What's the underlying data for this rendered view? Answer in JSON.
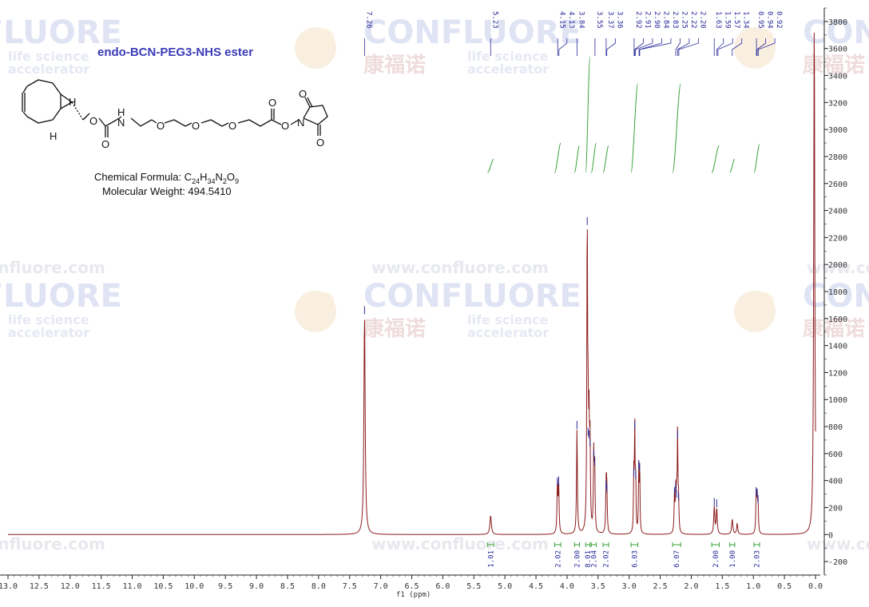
{
  "compound": {
    "name": "endo-BCN-PEG3-NHS ester",
    "formula_prefix": "Chemical Formula: ",
    "formula_parts": [
      [
        "C",
        false
      ],
      [
        "24",
        true
      ],
      [
        "H",
        false
      ],
      [
        "34",
        true
      ],
      [
        "N",
        false
      ],
      [
        "2",
        true
      ],
      [
        "O",
        false
      ],
      [
        "9",
        true
      ]
    ],
    "mw": "Molecular Weight: 494.5410"
  },
  "watermark": {
    "brand": "CONFLUORE",
    "cjk": "康福诺",
    "tag1": "life science",
    "tag2": "accelerator",
    "url": "www.confluore.com"
  },
  "colors": {
    "spectrum": "#8b1a1a",
    "integral_curve": "#3aa13a",
    "integral_marker": "#3aa13a",
    "peak_label": "#2a2a9a",
    "axis": "#222222"
  },
  "chart_data": {
    "type": "line",
    "xlabel": "f1 (ppm)",
    "xlim": [
      13.0,
      0.0
    ],
    "x_ticks": [
      "13.0",
      "12.5",
      "12.0",
      "11.5",
      "11.0",
      "10.5",
      "10.0",
      "9.5",
      "9.0",
      "8.5",
      "8.0",
      "7.5",
      "7.0",
      "6.5",
      "6.0",
      "5.5",
      "5.0",
      "4.5",
      "4.0",
      "3.5",
      "3.0",
      "2.5",
      "2.0",
      "1.5",
      "1.0",
      "0.5",
      "0.0"
    ],
    "ylim": [
      -300,
      3900
    ],
    "y_ticks": [
      "3800",
      "3600",
      "3400",
      "3200",
      "3000",
      "2800",
      "2600",
      "2400",
      "2200",
      "2000",
      "1800",
      "1600",
      "1400",
      "1200",
      "1000",
      "800",
      "600",
      "400",
      "200",
      "0",
      "-200"
    ],
    "peak_labels": [
      "7.26",
      "5.23",
      "4.15",
      "4.13",
      "3.84",
      "3.55",
      "3.37",
      "3.36",
      "2.92",
      "2.91",
      "2.90",
      "2.84",
      "2.83",
      "2.25",
      "2.22",
      "2.20",
      "1.63",
      "1.59",
      "1.57",
      "1.34",
      "0.95",
      "0.94",
      "0.92"
    ],
    "integrals": [
      {
        "from": 5.28,
        "to": 5.18,
        "value": "1.01"
      },
      {
        "from": 4.2,
        "to": 4.1,
        "value": "2.02"
      },
      {
        "from": 3.88,
        "to": 3.8,
        "value": "2.00"
      },
      {
        "from": 3.7,
        "to": 3.63,
        "value": "8.01"
      },
      {
        "from": 3.61,
        "to": 3.53,
        "value": "2.04"
      },
      {
        "from": 3.42,
        "to": 3.33,
        "value": "2.02"
      },
      {
        "from": 2.97,
        "to": 2.86,
        "value": "6.03"
      },
      {
        "from": 2.3,
        "to": 2.17,
        "value": "6.07"
      },
      {
        "from": 1.67,
        "to": 1.55,
        "value": "2.00"
      },
      {
        "from": 1.38,
        "to": 1.3,
        "value": "1.00"
      },
      {
        "from": 0.99,
        "to": 0.9,
        "value": "2.03"
      }
    ],
    "peaks": [
      {
        "ppm": 7.26,
        "height": 1620,
        "width": 0.012
      },
      {
        "ppm": 5.23,
        "height": 140,
        "width": 0.014
      },
      {
        "ppm": 4.155,
        "height": 350,
        "width": 0.008
      },
      {
        "ppm": 4.135,
        "height": 360,
        "width": 0.008
      },
      {
        "ppm": 3.84,
        "height": 770,
        "width": 0.008
      },
      {
        "ppm": 3.675,
        "height": 2280,
        "width": 0.007
      },
      {
        "ppm": 3.66,
        "height": 720,
        "width": 0.007
      },
      {
        "ppm": 3.645,
        "height": 700,
        "width": 0.007
      },
      {
        "ppm": 3.63,
        "height": 640,
        "width": 0.007
      },
      {
        "ppm": 3.57,
        "height": 560,
        "width": 0.007
      },
      {
        "ppm": 3.555,
        "height": 500,
        "width": 0.007
      },
      {
        "ppm": 3.37,
        "height": 330,
        "width": 0.008
      },
      {
        "ppm": 3.36,
        "height": 300,
        "width": 0.008
      },
      {
        "ppm": 2.925,
        "height": 420,
        "width": 0.006
      },
      {
        "ppm": 2.91,
        "height": 770,
        "width": 0.006
      },
      {
        "ppm": 2.895,
        "height": 400,
        "width": 0.006
      },
      {
        "ppm": 2.845,
        "height": 480,
        "width": 0.006
      },
      {
        "ppm": 2.83,
        "height": 460,
        "width": 0.006
      },
      {
        "ppm": 2.27,
        "height": 280,
        "width": 0.007
      },
      {
        "ppm": 2.25,
        "height": 310,
        "width": 0.007
      },
      {
        "ppm": 2.235,
        "height": 260,
        "width": 0.007
      },
      {
        "ppm": 2.22,
        "height": 700,
        "width": 0.006
      },
      {
        "ppm": 2.205,
        "height": 240,
        "width": 0.007
      },
      {
        "ppm": 1.63,
        "height": 200,
        "width": 0.01
      },
      {
        "ppm": 1.59,
        "height": 190,
        "width": 0.01
      },
      {
        "ppm": 1.34,
        "height": 110,
        "width": 0.012
      },
      {
        "ppm": 1.26,
        "height": 80,
        "width": 0.01
      },
      {
        "ppm": 0.955,
        "height": 280,
        "width": 0.007
      },
      {
        "ppm": 0.94,
        "height": 270,
        "width": 0.007
      },
      {
        "ppm": 0.925,
        "height": 220,
        "width": 0.007
      },
      {
        "ppm": 0.02,
        "height": 3820,
        "width": 0.01
      }
    ],
    "integral_curves": [
      {
        "from": 5.28,
        "to": 5.18,
        "start": 2680,
        "end": 2780
      },
      {
        "from": 4.2,
        "to": 4.1,
        "start": 2680,
        "end": 2900
      },
      {
        "from": 3.88,
        "to": 3.8,
        "start": 2680,
        "end": 2880
      },
      {
        "from": 3.7,
        "to": 3.63,
        "start": 2680,
        "end": 3540
      },
      {
        "from": 3.61,
        "to": 3.53,
        "start": 2680,
        "end": 2900
      },
      {
        "from": 3.42,
        "to": 3.33,
        "start": 2680,
        "end": 2880
      },
      {
        "from": 2.97,
        "to": 2.86,
        "start": 2680,
        "end": 3340
      },
      {
        "from": 2.3,
        "to": 2.17,
        "start": 2680,
        "end": 3340
      },
      {
        "from": 1.67,
        "to": 1.55,
        "start": 2680,
        "end": 2880
      },
      {
        "from": 1.38,
        "to": 1.3,
        "start": 2680,
        "end": 2780
      },
      {
        "from": 0.99,
        "to": 0.9,
        "start": 2680,
        "end": 2890
      }
    ]
  }
}
